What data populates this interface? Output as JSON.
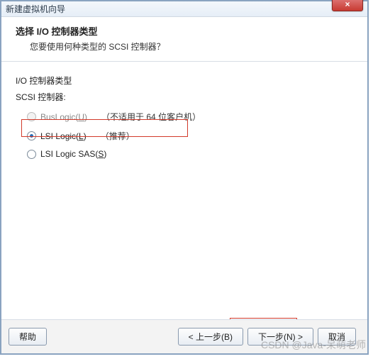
{
  "window": {
    "title": "新建虚拟机向导",
    "close_label": "×"
  },
  "header": {
    "title": "选择 I/O 控制器类型",
    "subtitle": "您要使用何种类型的 SCSI 控制器？"
  },
  "content": {
    "section_label": "I/O 控制器类型",
    "scsi_label": "SCSI 控制器:",
    "options": [
      {
        "label": "BusLogic(",
        "mnemonic": "U",
        "suffix": ")",
        "note": "（不适用于 64 位客户机）",
        "selected": false,
        "enabled": false
      },
      {
        "label": "LSI Logic(",
        "mnemonic": "L",
        "suffix": ")",
        "note": "（推荐）",
        "selected": true,
        "enabled": true
      },
      {
        "label": "LSI Logic SAS(",
        "mnemonic": "S",
        "suffix": ")",
        "note": "",
        "selected": false,
        "enabled": true
      }
    ]
  },
  "buttons": {
    "help": "帮助",
    "back": "< 上一步(B)",
    "next": "下一步(N) >",
    "cancel": "取消"
  },
  "watermark": "CSDN @Java-呆萌老师"
}
